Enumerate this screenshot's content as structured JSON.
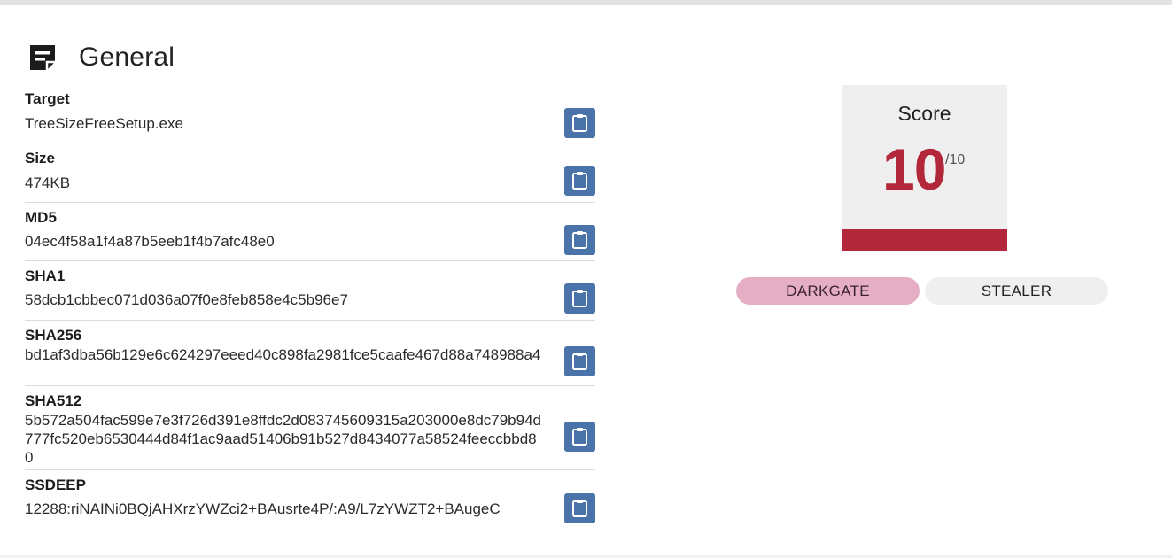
{
  "section": {
    "title": "General",
    "icon": "document-list-icon"
  },
  "details": [
    {
      "label": "Target",
      "value": "TreeSizeFreeSetup.exe"
    },
    {
      "label": "Size",
      "value": "474KB"
    },
    {
      "label": "MD5",
      "value": "04ec4f58a1f4a87b5eeb1f4b7afc48e0"
    },
    {
      "label": "SHA1",
      "value": "58dcb1cbbec071d036a07f0e8feb858e4c5b96e7"
    },
    {
      "label": "SHA256",
      "value": "bd1af3dba56b129e6c624297eeed40c898fa2981fce5caafe467d88a748988a4"
    },
    {
      "label": "SHA512",
      "value": "5b572a504fac599e7e3f726d391e8ffdc2d083745609315a203000e8dc79b94d777fc520eb6530444d84f1ac9aad51406b91b527d8434077a58524feeccbbd80"
    },
    {
      "label": "SSDEEP",
      "value": "12288:riNAINi0BQjAHXrzYWZci2+BAusrte4P/:A9/L7zYWZT2+BAugeC"
    }
  ],
  "copy_icon": "clipboard-icon",
  "score": {
    "label": "Score",
    "value": "10",
    "max": "/10"
  },
  "tags": [
    {
      "label": "DARKGATE",
      "color": "#e5aec4"
    },
    {
      "label": "STEALER",
      "color": "#efefef"
    }
  ],
  "colors": {
    "accent_button": "#4a74a9",
    "score_red": "#b2283a"
  }
}
